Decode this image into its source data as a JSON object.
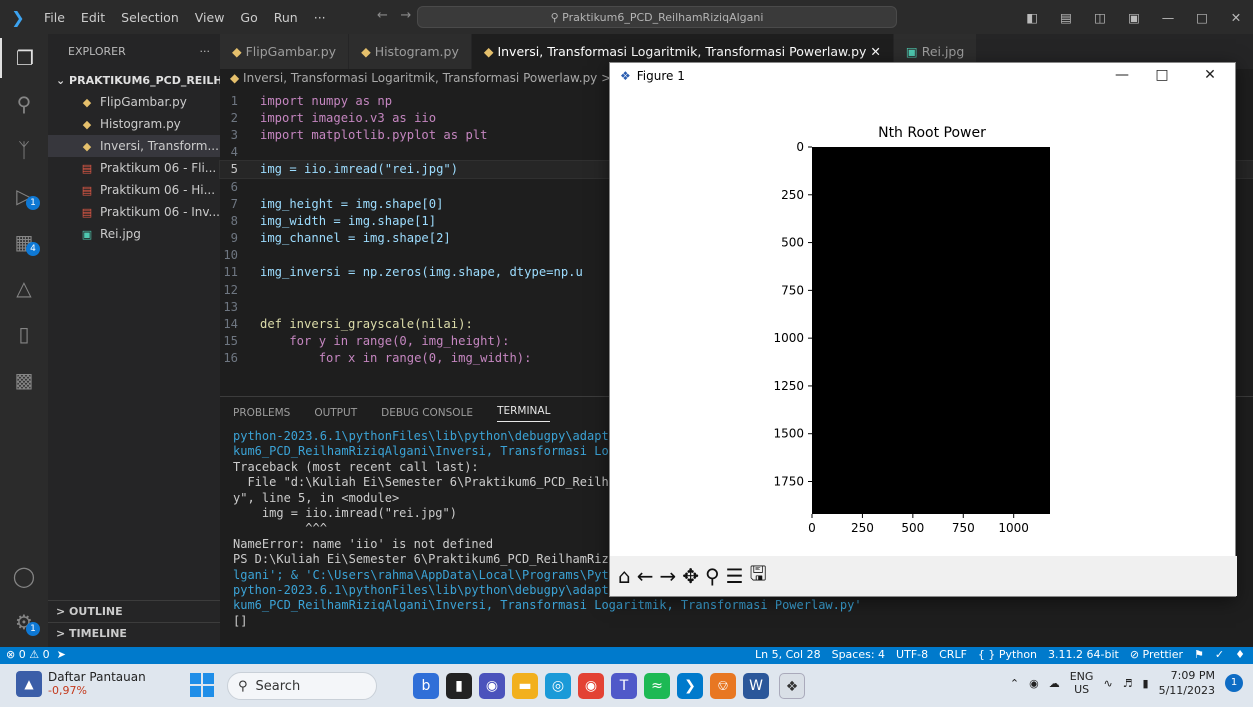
{
  "titlebar": {
    "menu": [
      "File",
      "Edit",
      "Selection",
      "View",
      "Go",
      "Run",
      "···"
    ],
    "search": "Praktikum6_PCD_ReilhamRiziqAlgani"
  },
  "activity": {
    "scm_badge": "1",
    "ext_badge": "4",
    "settings_badge": "1"
  },
  "sidebar": {
    "header": "EXPLORER",
    "folder": "PRAKTIKUM6_PCD_REILHA...",
    "files": [
      "FlipGambar.py",
      "Histogram.py",
      "Inversi, Transform...",
      "Praktikum 06 - Fli...",
      "Praktikum 06 - Hi...",
      "Praktikum 06 - Inv...",
      "Rei.jpg"
    ],
    "outline": "OUTLINE",
    "timeline": "TIMELINE"
  },
  "tabs": [
    "FlipGambar.py",
    "Histogram.py",
    "Inversi, Transformasi Logaritmik, Transformasi Powerlaw.py",
    "Rei.jpg"
  ],
  "breadcrumb": "Inversi, Transformasi Logaritmik, Transformasi Powerlaw.py > ...",
  "code": {
    "l1": "import numpy as np",
    "l2": "import imageio.v3 as iio",
    "l3": "import matplotlib.pyplot as plt",
    "l5": "img = iio.imread(\"rei.jpg\")",
    "l7": "img_height = img.shape[0]",
    "l8": "img_width = img.shape[1]",
    "l9": "img_channel = img.shape[2]",
    "l11": "img_inversi = np.zeros(img.shape, dtype=np.u",
    "l14": "def inversi_grayscale(nilai):",
    "l15": "    for y in range(0, img_height):",
    "l16": "        for x in range(0, img_width):"
  },
  "panel": {
    "tabs": [
      "PROBLEMS",
      "OUTPUT",
      "DEBUG CONSOLE",
      "TERMINAL"
    ],
    "terminal": [
      "python-2023.6.1\\pythonFiles\\lib\\python\\debugpy\\adapt",
      "kum6_PCD_ReilhamRiziqAlgani\\Inversi, Transformasi Lo",
      "Traceback (most recent call last):",
      "  File \"d:\\Kuliah Ei\\Semester 6\\Praktikum6_PCD_Reilh",
      "y\", line 5, in <module>",
      "    img = iio.imread(\"rei.jpg\")",
      "          ^^^",
      "NameError: name 'iio' is not defined",
      "PS D:\\Kuliah Ei\\Semester 6\\Praktikum6_PCD_ReilhamRiz",
      "lgani'; & 'C:\\Users\\rahma\\AppData\\Local\\Programs\\Pyt",
      "python-2023.6.1\\pythonFiles\\lib\\python\\debugpy\\adapter/../..\\debugpy\\launcher' '56735' '--' 'd:\\Kuliah Ei\\Semester 6\\Prakti",
      "kum6_PCD_ReilhamRiziqAlgani\\Inversi, Transformasi Logaritmik, Transformasi Powerlaw.py'",
      "[]"
    ]
  },
  "statusbar": {
    "left": "⊗ 0 ⚠ 0",
    "right": [
      "Ln 5, Col 28",
      "Spaces: 4",
      "UTF-8",
      "CRLF",
      "{ } Python",
      "3.11.2 64-bit",
      "⊘ Prettier"
    ]
  },
  "figure": {
    "window_title": "Figure 1",
    "plot_title": "Nth Root Power"
  },
  "chart_data": {
    "type": "heatmap",
    "title": "Nth Root Power",
    "xlabel": "",
    "ylabel": "",
    "xticks": [
      0,
      250,
      500,
      750,
      1000
    ],
    "yticks": [
      0,
      250,
      500,
      750,
      1000,
      1250,
      1500,
      1750
    ],
    "xlim": [
      0,
      1180
    ],
    "ylim": [
      1920,
      0
    ],
    "image_fill": "#000000"
  },
  "taskbar": {
    "weather_title": "Daftar Pantauan",
    "weather_value": "-0,97%",
    "search": "Search",
    "lang1": "ENG",
    "lang2": "US",
    "time": "7:09 PM",
    "date": "5/11/2023",
    "notif": "1"
  }
}
